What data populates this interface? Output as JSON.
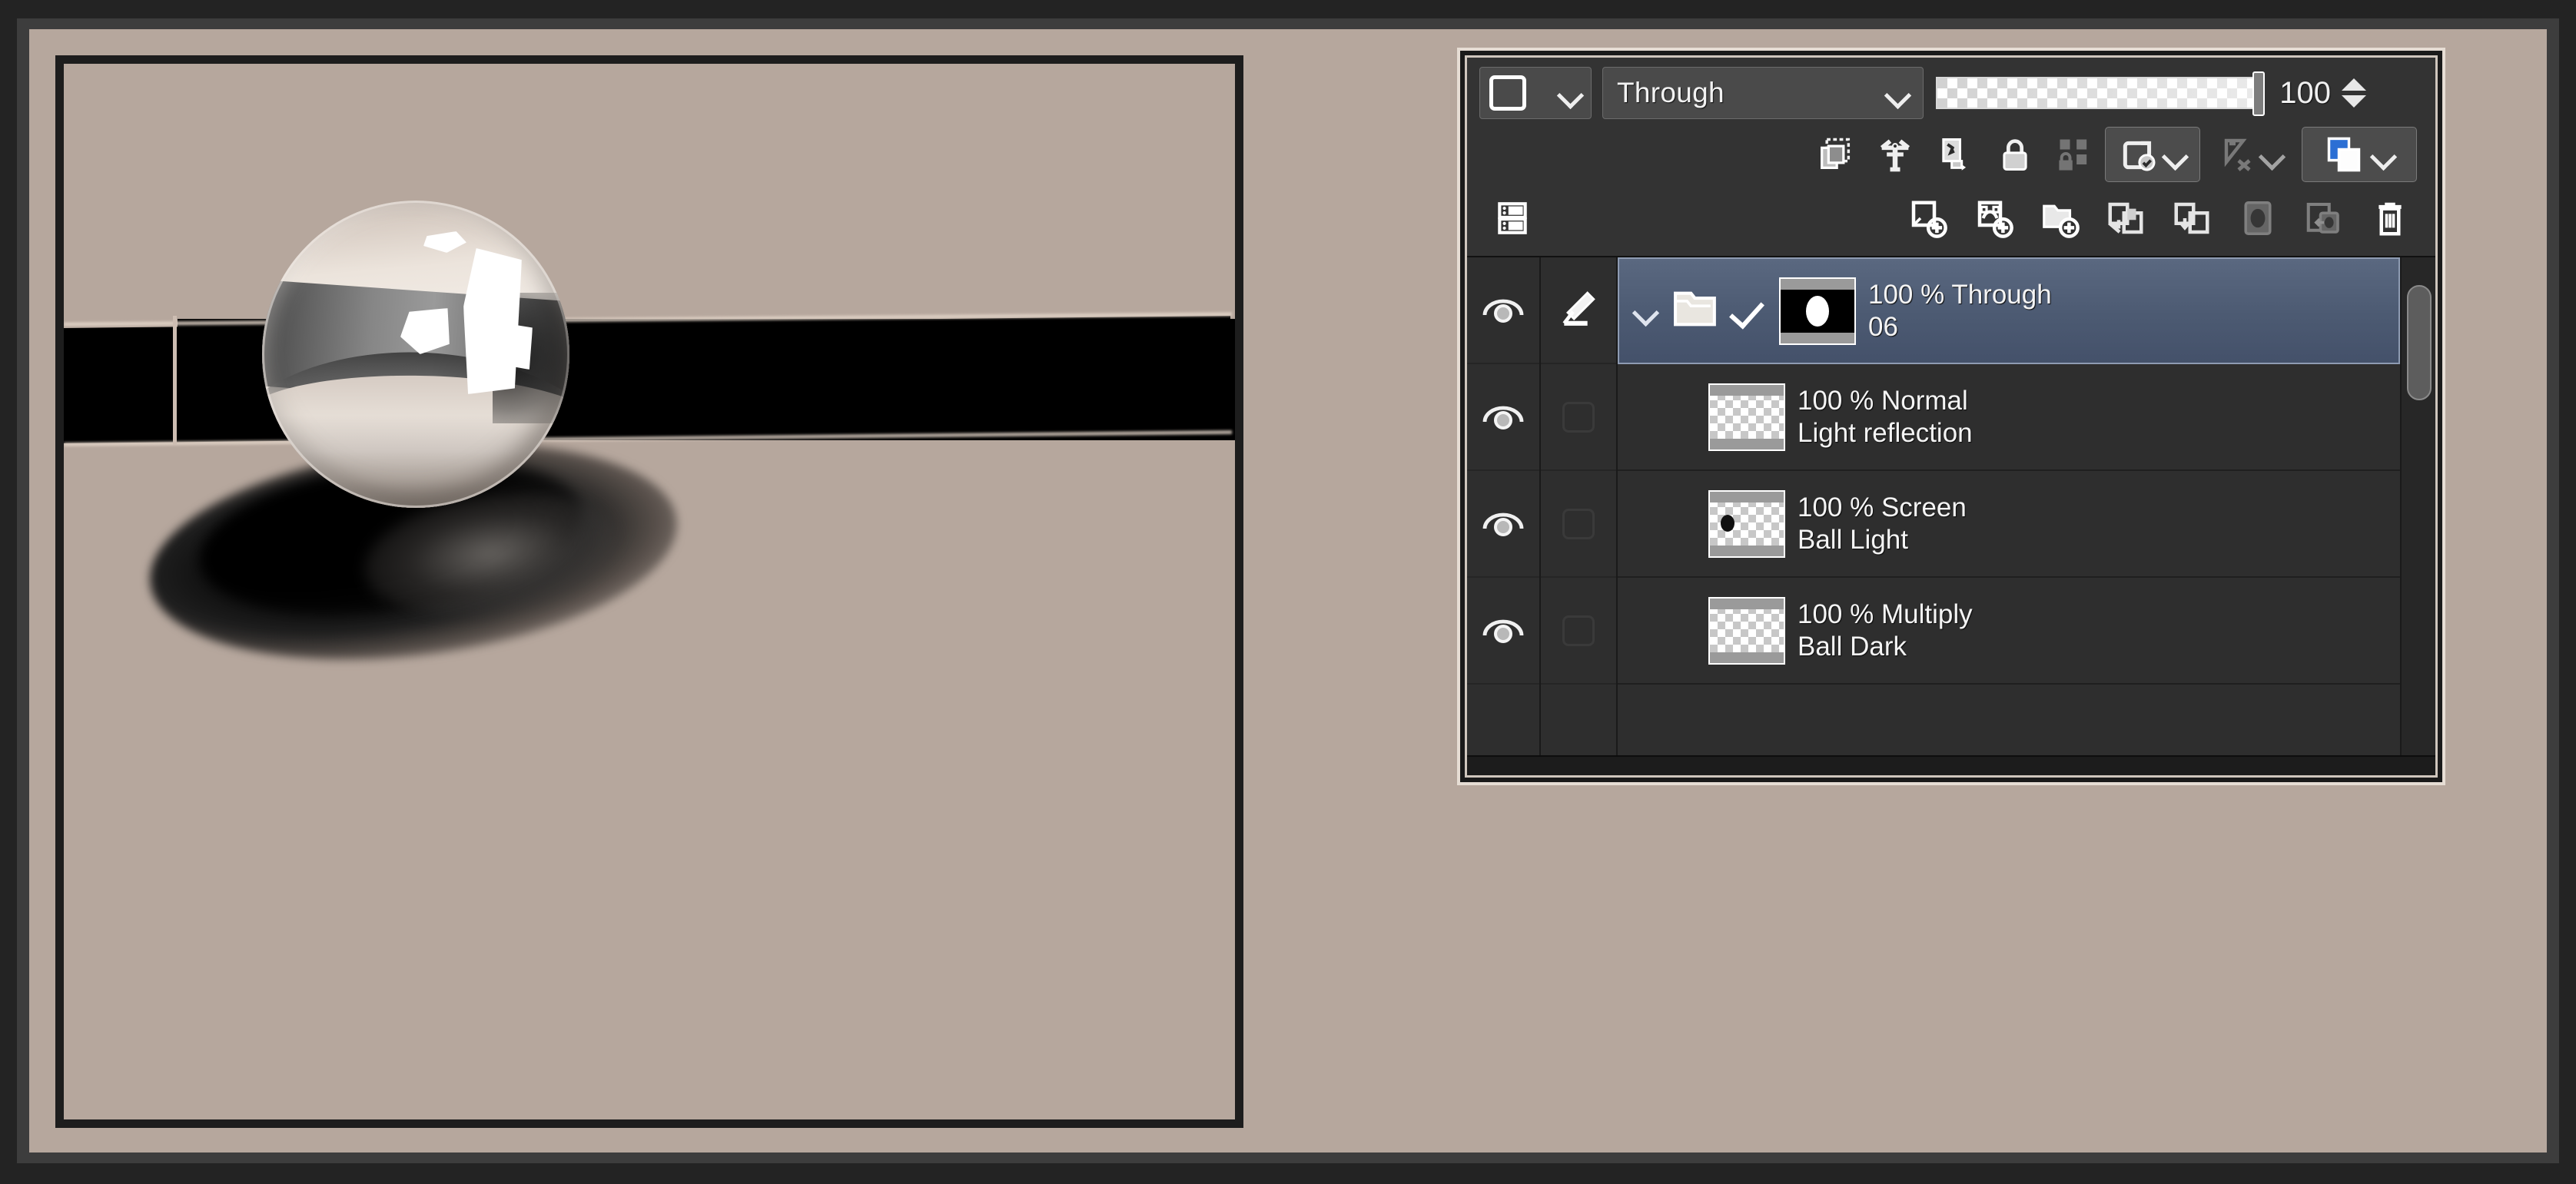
{
  "app": {
    "panel_title": "Layer",
    "canvas_title": "Chrome ball illustration"
  },
  "toolbar": {
    "mask_select_label": "mask-swatch",
    "blend_mode": "Through",
    "blend_dropdown_icon": "chevron-down-icon",
    "mask_dropdown_icon": "chevron-down-icon",
    "opacity_value": "100",
    "opacity_slider_name": "opacity-slider",
    "spin_up_icon": "spinner-up-icon",
    "spin_down_icon": "spinner-down-icon",
    "row2": [
      {
        "name": "clip-to-layer-below-icon",
        "label": "Clip to layer below"
      },
      {
        "name": "ruler-icon",
        "label": "Show ruler on all layers"
      },
      {
        "name": "lock-transparent-pixels-icon",
        "label": "Lock transparent pixels"
      },
      {
        "name": "lock-layer-icon",
        "label": "Lock layer"
      },
      {
        "name": "grid-lock-icon",
        "label": "Grid lock"
      },
      {
        "name": "layer-color-icon",
        "label": "Layer color"
      },
      {
        "name": "no-draw-icon",
        "label": "Set as draft layer"
      },
      {
        "name": "layer-palette-color-icon",
        "label": "Palette color"
      }
    ],
    "row3": [
      {
        "name": "layer-properties-icon",
        "label": "Layer properties"
      },
      {
        "name": "new-raster-layer-icon",
        "label": "New raster layer"
      },
      {
        "name": "new-vector-layer-icon",
        "label": "New vector layer"
      },
      {
        "name": "new-layer-folder-icon",
        "label": "New layer folder"
      },
      {
        "name": "transfer-down-icon",
        "label": "Transfer to layer below"
      },
      {
        "name": "combine-down-icon",
        "label": "Combine to layer below"
      },
      {
        "name": "layer-mask-icon",
        "label": "Create layer mask"
      },
      {
        "name": "mask-to-selection-icon",
        "label": "Apply mask to layer"
      },
      {
        "name": "delete-layer-icon",
        "label": "Delete layer"
      }
    ]
  },
  "layers": [
    {
      "selected": true,
      "visible": true,
      "eye_icon": "eye-icon",
      "edit_icon": "edit-pencil-icon",
      "expand_icon": "chevron-down-icon",
      "kind_icon": "folder-icon",
      "check_icon": "check-icon",
      "thumb": "mask-thumbnail",
      "mode": "100 % Through",
      "name": "06"
    },
    {
      "selected": false,
      "visible": true,
      "eye_icon": "eye-icon",
      "edit_icon": "edit-placeholder-icon",
      "thumb": "checker-thumbnail",
      "mode": "100 % Normal",
      "name": "Light reflection"
    },
    {
      "selected": false,
      "visible": true,
      "eye_icon": "eye-icon",
      "edit_icon": "edit-placeholder-icon",
      "thumb": "checker-thumbnail-dot",
      "mode": "100 % Screen",
      "name": "Ball Light"
    },
    {
      "selected": false,
      "visible": true,
      "eye_icon": "eye-icon",
      "edit_icon": "edit-placeholder-icon",
      "thumb": "checker-thumbnail",
      "mode": "100 % Multiply",
      "name": "Ball Dark"
    }
  ],
  "scrollbar": {
    "name": "layer-list-scrollbar",
    "thumb_position": "top"
  },
  "colors": {
    "canvas_bg": "#b6a79d",
    "frame_outer": "#232323",
    "frame_band": "#3d3d3d",
    "panel_bg": "#2e2e2e",
    "toolbar_bg": "#333333",
    "selected_row": "#4c5a72",
    "text": "#f4f4f4",
    "accent_blue": "#2b6fd4"
  }
}
